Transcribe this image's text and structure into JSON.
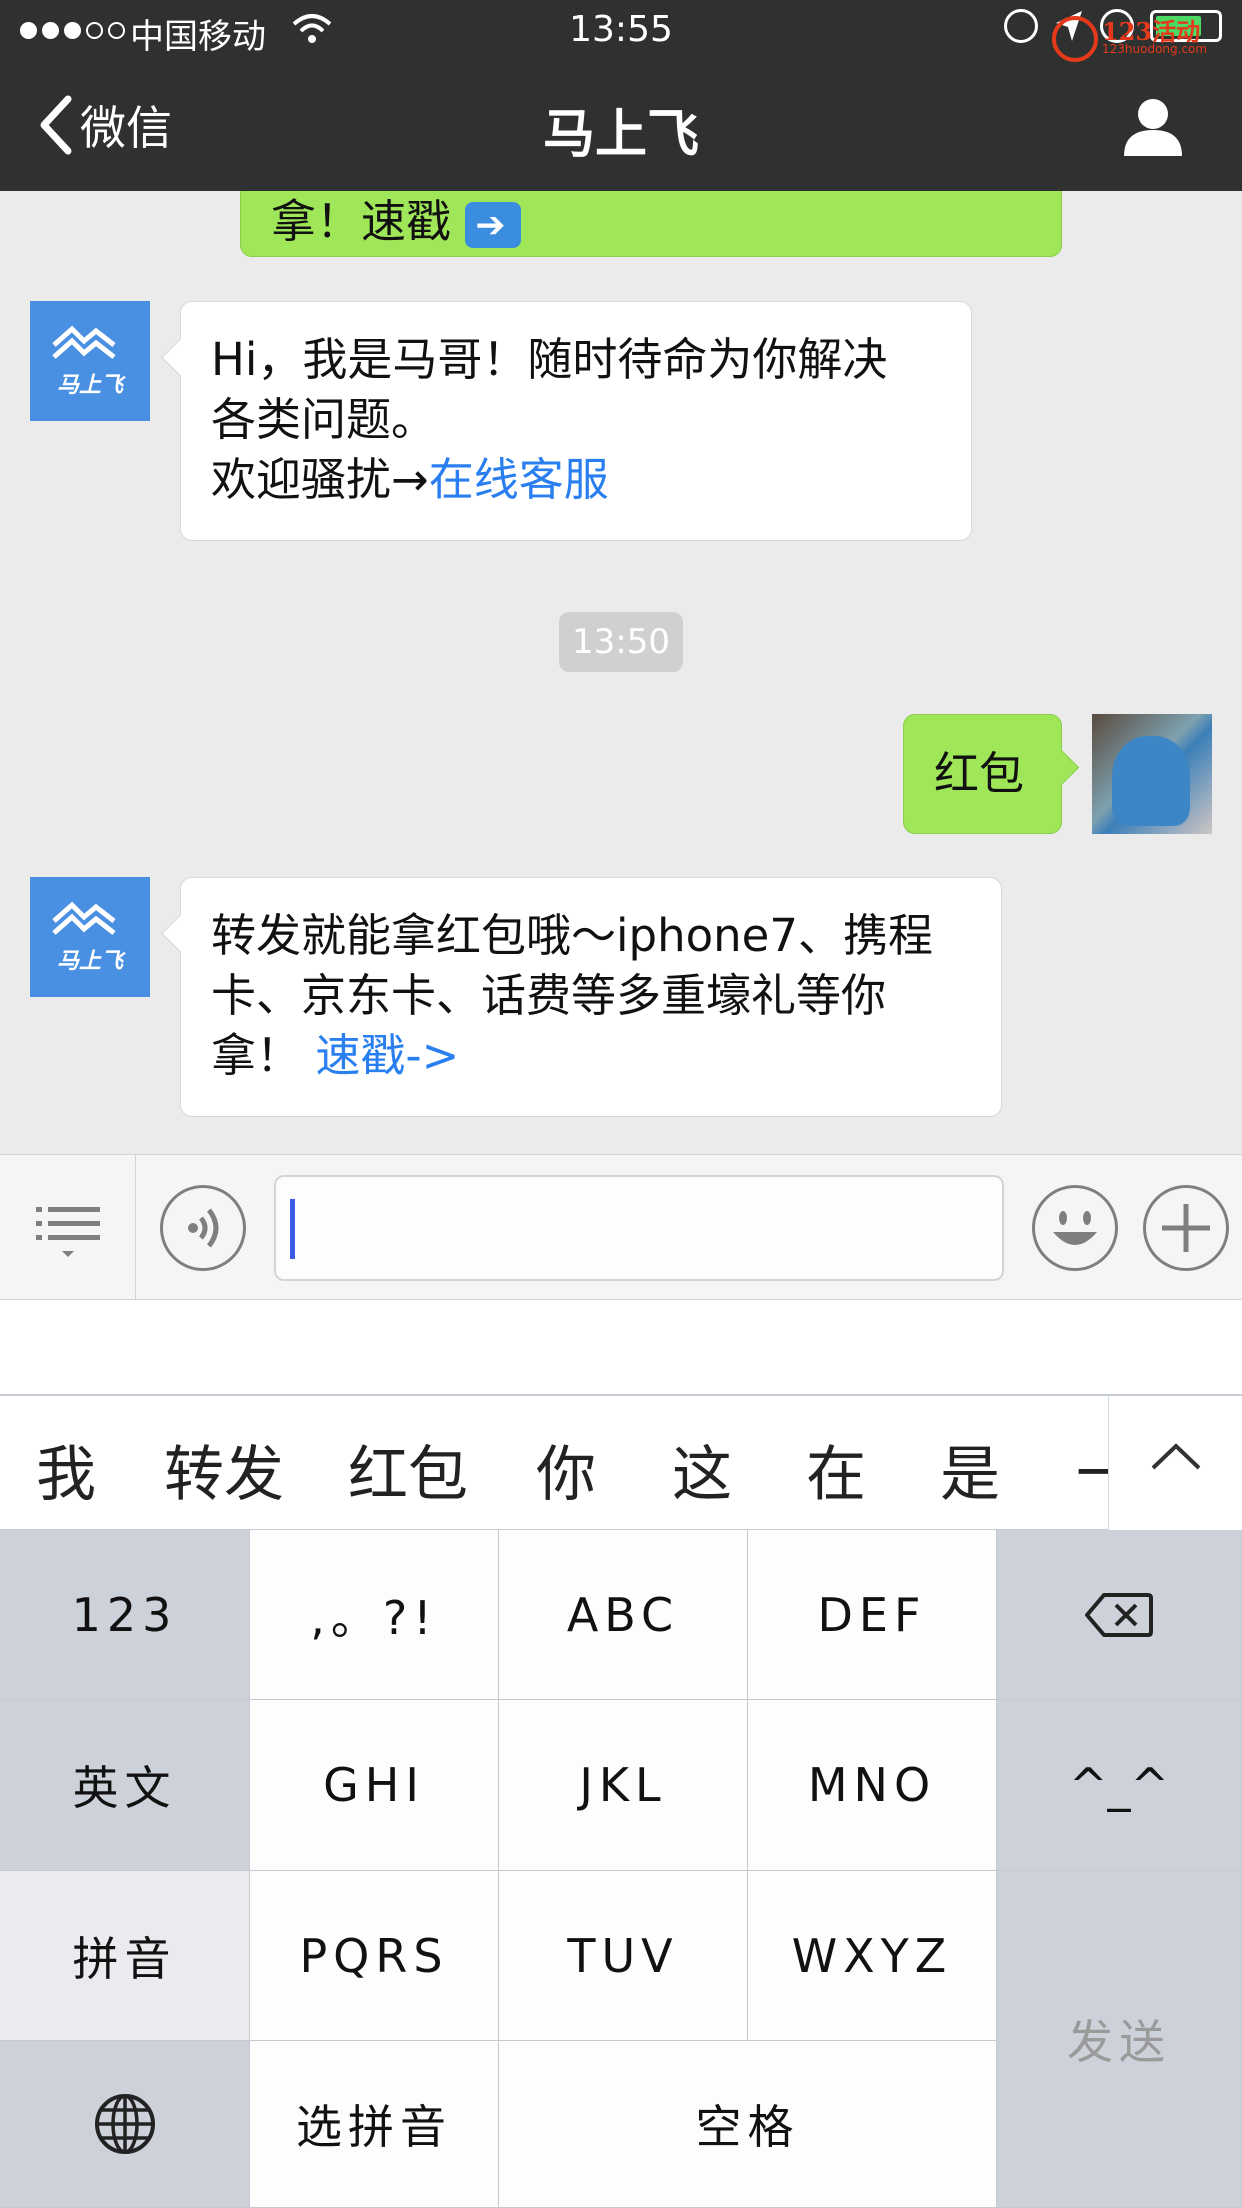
{
  "status_bar": {
    "carrier": "中国移动",
    "time": "13:55",
    "battery_level": 0.75
  },
  "watermark": {
    "text": "123活动",
    "url_text": "123huodong.com"
  },
  "nav": {
    "back_label": "微信",
    "title": "马上飞"
  },
  "chat": {
    "partial_message": "拿！速戳",
    "messages": [
      {
        "sender": "bot",
        "line1": "Hi，我是马哥！随时待命为你解决",
        "line2": "各类问题。",
        "line3_prefix": "欢迎骚扰→",
        "line3_link": "在线客服"
      },
      {
        "timestamp": "13:50"
      },
      {
        "sender": "user",
        "text": "红包"
      },
      {
        "sender": "bot",
        "line1": "转发就能拿红包哦～iphone7、携程",
        "line2": "卡、京东卡、话费等多重壕礼等你",
        "line3_prefix": "拿！",
        "line3_link": "速戳->"
      }
    ],
    "bot_avatar_text": "马上飞"
  },
  "candidates": [
    "我",
    "转发",
    "红包",
    "你",
    "这",
    "在",
    "是",
    "一"
  ],
  "keyboard": {
    "rows": [
      [
        "123",
        ",。?!",
        "ABC",
        "DEF"
      ],
      [
        "英文",
        "GHI",
        "JKL",
        "MNO",
        "^_^"
      ],
      [
        "拼音",
        "PQRS",
        "TUV",
        "WXYZ"
      ],
      [
        "选拼音",
        "空格"
      ]
    ],
    "send_label": "发送"
  }
}
